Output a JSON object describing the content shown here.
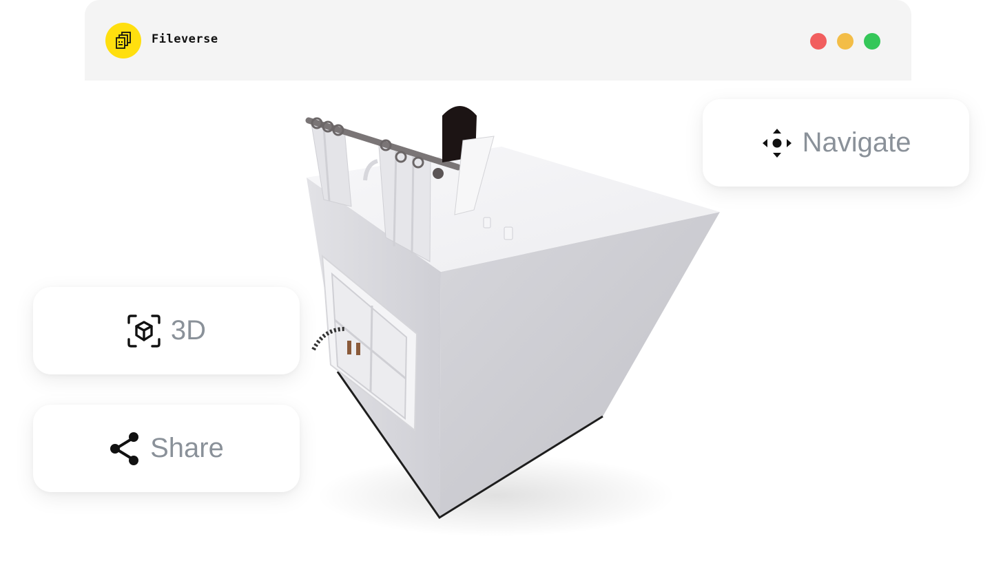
{
  "app": {
    "title": "Fileverse",
    "logo_icon": "fileverse-logo-icon",
    "brand_color": "#ffdf0f"
  },
  "window_controls": {
    "close_color": "#f15e5e",
    "minimize_color": "#f3bd47",
    "maximize_color": "#35c759"
  },
  "actions": {
    "navigate": {
      "label": "Navigate",
      "icon": "move-arrows-icon"
    },
    "view3d": {
      "label": "3D",
      "icon": "cube-scan-icon"
    },
    "share": {
      "label": "Share",
      "icon": "share-icon"
    }
  },
  "viewer": {
    "content": "3d-room-model"
  }
}
